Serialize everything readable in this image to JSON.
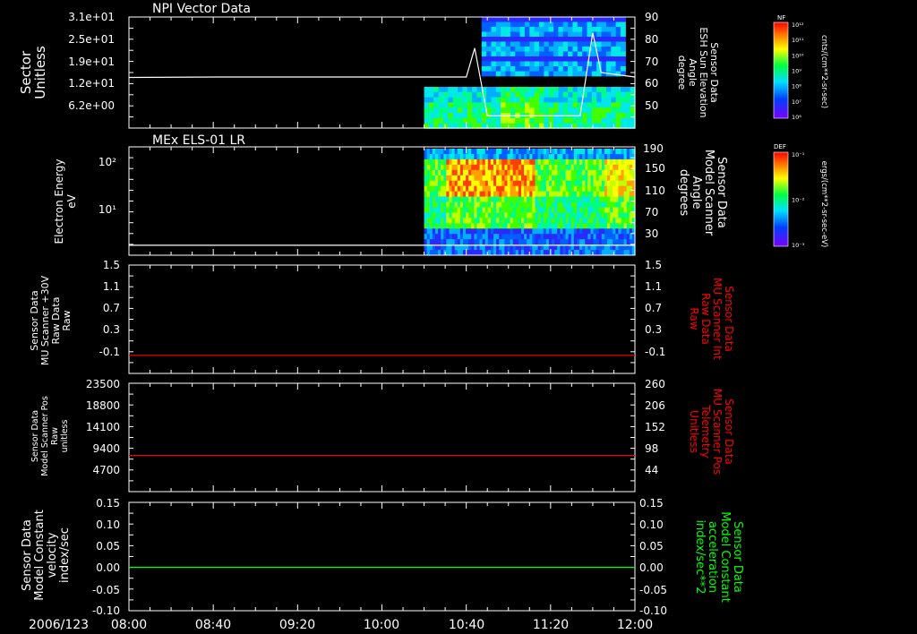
{
  "date_label": "2006/123",
  "x_ticks": [
    "08:00",
    "08:40",
    "09:20",
    "10:00",
    "10:40",
    "11:20",
    "12:00"
  ],
  "colors": {
    "background": "#000000",
    "axis": "#ffffff",
    "red_trace": "#ff0000",
    "green_trace": "#00ff00"
  },
  "panels": {
    "p1": {
      "title": "NPI Vector Data",
      "left_label": [
        "Sector",
        "Unitless"
      ],
      "left_ticks": [
        "3.1e+01",
        "2.5e+01",
        "1.9e+01",
        "1.2e+01",
        "6.2e+00"
      ],
      "right_label": [
        "Sensor Data",
        "ESH Sun Elevation",
        "Angle",
        "degree"
      ],
      "right_ticks": [
        "90",
        "80",
        "70",
        "60",
        "50"
      ],
      "colorbar": {
        "name": "NF",
        "unit": "cnts/(cm**2-sr-sec)",
        "ticks": [
          "10¹²",
          "10¹¹",
          "10¹⁰",
          "10⁹",
          "10⁸",
          "10⁷",
          "10⁶"
        ]
      }
    },
    "p2": {
      "title": "MEx ELS-01 LR",
      "left_label": [
        "Electron Energy",
        "eV"
      ],
      "left_ticks": [
        "10²",
        "10¹"
      ],
      "right_label": [
        "Sensor Data",
        "Model Scanner",
        "Angle",
        "degrees"
      ],
      "right_ticks": [
        "190",
        "150",
        "110",
        "70",
        "30"
      ],
      "colorbar": {
        "name": "DEF",
        "unit": "ergs/(cm**2-sr-sec-eV)",
        "ticks": [
          "10⁻¹",
          "10⁻²",
          "10⁻³"
        ]
      }
    },
    "p3": {
      "left_label": [
        "Sensor Data",
        "MU Scanner +30V",
        "Raw Data",
        "Raw"
      ],
      "left_ticks": [
        "1.5",
        "1.1",
        "0.7",
        "0.3",
        "-0.1"
      ],
      "right_label": [
        "Sensor Data",
        "MU Scanner Int",
        "Raw Data",
        "Raw"
      ],
      "right_ticks": [
        "1.5",
        "1.1",
        "0.7",
        "0.3",
        "-0.1"
      ]
    },
    "p4": {
      "left_label": [
        "Sensor Data",
        "Model Scanner Pos",
        "Raw",
        "unitless"
      ],
      "left_ticks": [
        "23500",
        "18800",
        "14100",
        "9400",
        "4700"
      ],
      "right_label": [
        "Sensor Data",
        "MU Scanner Pos",
        "Telemetry",
        "Unitless"
      ],
      "right_ticks": [
        "260",
        "206",
        "152",
        "98",
        "44"
      ]
    },
    "p5": {
      "left_label": [
        "Sensor Data",
        "Model Constant",
        "velocity",
        "index/sec"
      ],
      "left_ticks": [
        "0.15",
        "0.10",
        "0.05",
        "0.00",
        "-0.05",
        "-0.10"
      ],
      "right_label": [
        "Sensor Data",
        "Model Constant",
        "acceleration",
        "index/sec**2"
      ],
      "right_ticks": [
        "0.15",
        "0.10",
        "0.05",
        "0.00",
        "-0.05",
        "-0.10"
      ]
    }
  },
  "chart_data": [
    {
      "type": "heatmap",
      "title": "NPI Vector Data",
      "x_range": [
        "08:00",
        "12:00"
      ],
      "data_start": "10:20",
      "ylabel": "Sector Unitless",
      "y2label": "Sensor Data ESH Sun Elevation Angle degree",
      "overlay_line": {
        "x": [
          "08:00",
          "08:40",
          "10:00",
          "10:40",
          "10:44",
          "10:50",
          "11:20",
          "11:34",
          "11:40",
          "11:44",
          "12:00"
        ],
        "y": [
          62.8,
          63.0,
          63.0,
          63.0,
          76.0,
          45.5,
          45.5,
          45.5,
          83.0,
          65.0,
          63.0
        ]
      }
    },
    {
      "type": "heatmap",
      "title": "MEx ELS-01 LR",
      "x_range": [
        "08:00",
        "12:00"
      ],
      "data_start": "10:20",
      "ylabel": "Electron Energy eV",
      "y2label": "Sensor Data Model Scanner Angle degrees",
      "overlay_line": {
        "x": [
          "08:00",
          "12:00"
        ],
        "y": [
          22,
          22
        ]
      }
    },
    {
      "type": "line",
      "series": [
        {
          "x": [
            "08:00",
            "12:00"
          ],
          "y": [
            0.0,
            0.0
          ]
        }
      ],
      "ylim": [
        -0.3,
        1.5
      ]
    },
    {
      "type": "line",
      "series": [
        {
          "x": [
            "08:00",
            "12:00"
          ],
          "y": [
            7850,
            7850
          ]
        }
      ],
      "ylim": [
        0,
        23500
      ]
    },
    {
      "type": "line",
      "series": [
        {
          "x": [
            "08:00",
            "12:00"
          ],
          "y": [
            0.0,
            0.0
          ]
        }
      ],
      "ylim": [
        -0.1,
        0.15
      ]
    }
  ]
}
